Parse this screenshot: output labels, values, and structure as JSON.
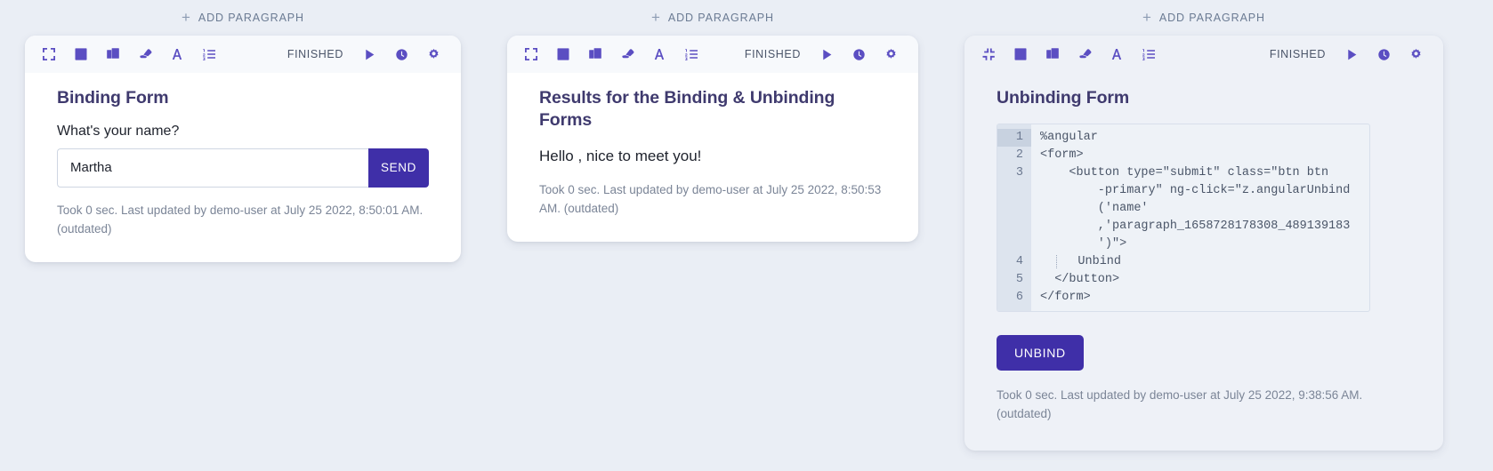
{
  "app": {
    "background_color": "#eaeef5",
    "accent_color": "#3f2fa8",
    "icon_color": "#5b4ec2",
    "heading_color": "#3f3a6e",
    "meta_color": "#7b8597"
  },
  "add_paragraph": {
    "label": "ADD PARAGRAPH",
    "plus": "+"
  },
  "toolbar": {
    "status_label": "FINISHED",
    "icons_left": [
      {
        "name": "expand-icon",
        "title": "Expand"
      },
      {
        "name": "book-icon",
        "title": "Book"
      },
      {
        "name": "copy-icon",
        "title": "Copy"
      },
      {
        "name": "eraser-icon",
        "title": "Clear output"
      },
      {
        "name": "font-icon",
        "title": "Font size"
      },
      {
        "name": "list-ordered-icon",
        "title": "Line numbers"
      }
    ],
    "icons_left_collapsed_first": {
      "name": "collapse-icon",
      "title": "Collapse"
    },
    "icons_right": [
      {
        "name": "play-icon",
        "title": "Run"
      },
      {
        "name": "clock-icon",
        "title": "Schedule"
      },
      {
        "name": "gear-icon",
        "title": "Settings"
      }
    ]
  },
  "cards": [
    {
      "id": "binding-form",
      "heading": "Binding Form",
      "question": "What's your name?",
      "input": {
        "value": "Martha",
        "placeholder": ""
      },
      "send_label": "SEND",
      "meta": "Took 0 sec. Last updated by demo-user at July 25 2022, 8:50:01 AM. (outdated)"
    },
    {
      "id": "results",
      "heading": "Results for the Binding & Unbinding Forms",
      "greeting": "Hello , nice to meet you!",
      "meta": "Took 0 sec. Last updated by demo-user at July 25 2022, 8:50:53 AM. (outdated)"
    },
    {
      "id": "unbinding-form",
      "heading": "Unbinding Form",
      "editor": {
        "lines": [
          {
            "number": "1",
            "active": true,
            "segments": [
              {
                "text": "%angular",
                "guide": false
              }
            ]
          },
          {
            "number": "2",
            "active": false,
            "segments": [
              {
                "text": "<form>",
                "guide": false
              }
            ]
          },
          {
            "number": "3",
            "active": false,
            "segments": [
              {
                "text": "    <button type=\"submit\" class=\"btn btn",
                "guide": false
              }
            ]
          },
          {
            "number": "",
            "active": false,
            "segments": [
              {
                "text": "        -primary\" ng-click=\"z.angularUnbind",
                "guide": false
              }
            ]
          },
          {
            "number": "",
            "active": false,
            "segments": [
              {
                "text": "        ('name'",
                "guide": false
              }
            ]
          },
          {
            "number": "",
            "active": false,
            "segments": [
              {
                "text": "        ,'paragraph_1658728178308_489139183",
                "guide": false
              }
            ]
          },
          {
            "number": "",
            "active": false,
            "segments": [
              {
                "text": "        ')\">",
                "guide": false
              }
            ]
          },
          {
            "number": "4",
            "active": false,
            "segments": [
              {
                "text": "    Unbind",
                "guide": true
              }
            ]
          },
          {
            "number": "5",
            "active": false,
            "segments": [
              {
                "text": "  </button>",
                "guide": false
              }
            ]
          },
          {
            "number": "6",
            "active": false,
            "segments": [
              {
                "text": "</form>",
                "guide": false
              }
            ]
          }
        ]
      },
      "unbind_label": "UNBIND",
      "meta": "Took 0 sec. Last updated by demo-user at July 25 2022, 9:38:56 AM. (outdated)"
    }
  ]
}
